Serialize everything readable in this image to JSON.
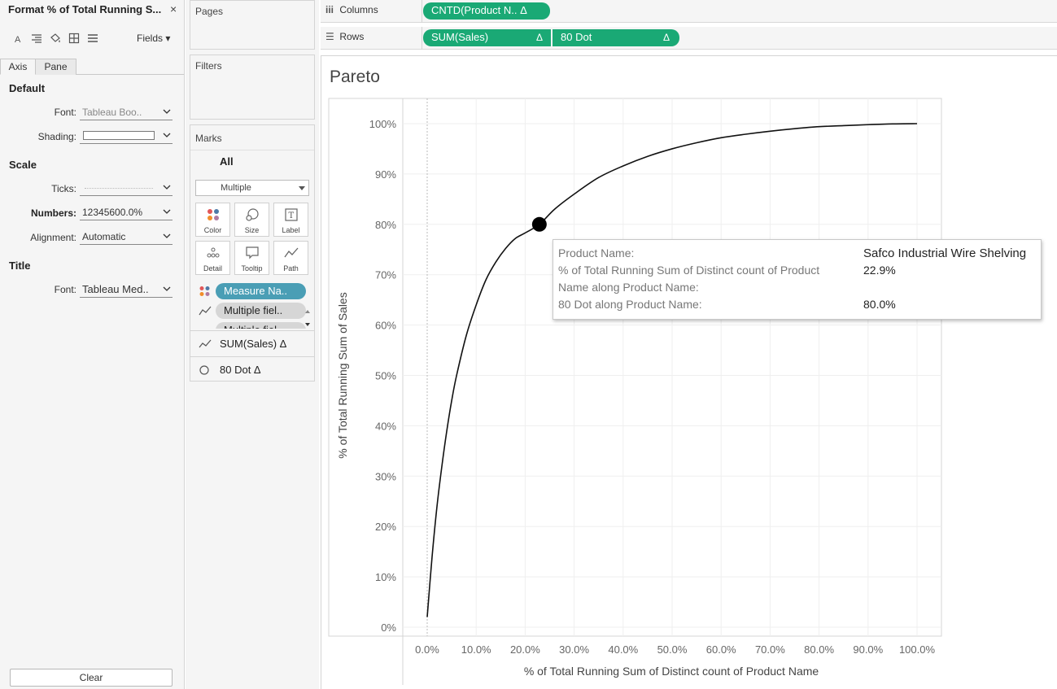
{
  "format_pane": {
    "title": "Format % of Total Running S...",
    "close": "×",
    "fields_label": "Fields ▾",
    "tabs": [
      "Axis",
      "Pane"
    ],
    "default_section": "Default",
    "font_label": "Font:",
    "font_value": "Tableau Boo..",
    "shading_label": "Shading:",
    "scale_section": "Scale",
    "ticks_label": "Ticks:",
    "numbers_label": "Numbers:",
    "numbers_value": "12345600.0%",
    "alignment_label": "Alignment:",
    "alignment_value": "Automatic",
    "title_section": "Title",
    "title_font_label": "Font:",
    "title_font_value": "Tableau Med..",
    "clear_label": "Clear"
  },
  "cards": {
    "pages": "Pages",
    "filters": "Filters",
    "marks": "Marks",
    "marks_all": "All",
    "mark_type": "Multiple",
    "buttons": [
      "Color",
      "Size",
      "Label",
      "Detail",
      "Tooltip",
      "Path"
    ],
    "pills": [
      "Measure Na..",
      "Multiple fiel..",
      "Multiple fiel.."
    ],
    "layers": [
      "SUM(Sales) Δ",
      "80 Dot Δ"
    ]
  },
  "shelves": {
    "columns_label": "Columns",
    "rows_label": "Rows",
    "columns_pills": [
      "CNTD(Product N.. Δ"
    ],
    "rows_pills": [
      "SUM(Sales)",
      "80 Dot"
    ],
    "delta": "Δ"
  },
  "tooltip": {
    "rows": [
      {
        "key": "Product Name:",
        "value": "Safco Industrial Wire Shelving"
      },
      {
        "key": "% of Total Running Sum of Distinct count of Product",
        "value": "22.9%"
      },
      {
        "key": "Name along Product Name:",
        "value": ""
      },
      {
        "key": "80 Dot along Product Name:",
        "value": "80.0%"
      }
    ]
  },
  "chart_data": {
    "type": "line",
    "title": "Pareto",
    "xlabel": "% of Total Running Sum of Distinct count of Product Name",
    "ylabel": "% of Total Running Sum of Sales",
    "xlim": [
      0,
      100
    ],
    "ylim": [
      0,
      100
    ],
    "x_ticks": [
      "0.0%",
      "10.0%",
      "20.0%",
      "30.0%",
      "40.0%",
      "50.0%",
      "60.0%",
      "70.0%",
      "80.0%",
      "90.0%",
      "100.0%"
    ],
    "y_ticks": [
      "0%",
      "10%",
      "20%",
      "30%",
      "40%",
      "50%",
      "60%",
      "70%",
      "80%",
      "90%",
      "100%"
    ],
    "grid": true,
    "series": [
      {
        "x": [
          0,
          1,
          2,
          3,
          4,
          5,
          6,
          8,
          10,
          12,
          14,
          16,
          18,
          20,
          22.9,
          26,
          30,
          35,
          40,
          45,
          50,
          55,
          60,
          65,
          70,
          75,
          80,
          85,
          90,
          95,
          100
        ],
        "y": [
          2,
          14,
          24,
          32,
          39,
          45,
          50,
          58,
          64,
          69,
          72.5,
          75.2,
          77.2,
          78.3,
          80,
          83,
          86,
          89.3,
          91.6,
          93.5,
          95,
          96.2,
          97.2,
          97.9,
          98.5,
          99,
          99.4,
          99.6,
          99.8,
          99.95,
          100
        ]
      },
      {
        "x": [
          22.9
        ],
        "y": [
          80
        ]
      }
    ]
  }
}
